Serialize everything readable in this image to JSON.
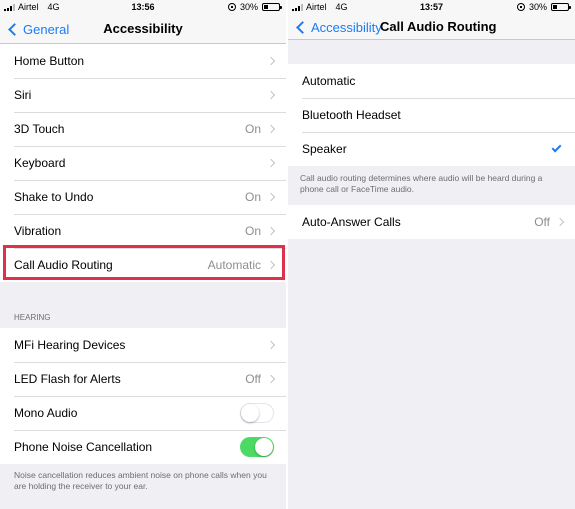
{
  "left": {
    "status": {
      "carrier": "Airtel",
      "network": "4G",
      "time": "13:56",
      "battery": "30%",
      "battery_level": 0.3
    },
    "nav": {
      "back_label": "General",
      "title": "Accessibility"
    },
    "rows": [
      {
        "label": "Home Button",
        "value": ""
      },
      {
        "label": "Siri",
        "value": ""
      },
      {
        "label": "3D Touch",
        "value": "On"
      },
      {
        "label": "Keyboard",
        "value": ""
      },
      {
        "label": "Shake to Undo",
        "value": "On"
      },
      {
        "label": "Vibration",
        "value": "On"
      },
      {
        "label": "Call Audio Routing",
        "value": "Automatic"
      }
    ],
    "hearing": {
      "header": "HEARING",
      "rows": [
        {
          "label": "MFi Hearing Devices",
          "value": ""
        },
        {
          "label": "LED Flash for Alerts",
          "value": "Off"
        },
        {
          "label": "Mono Audio",
          "toggle": "off"
        },
        {
          "label": "Phone Noise Cancellation",
          "toggle": "on"
        }
      ],
      "footer": "Noise cancellation reduces ambient noise on phone calls when you are holding the receiver to your ear."
    },
    "highlight_color": "#e0314c"
  },
  "right": {
    "status": {
      "carrier": "Airtel",
      "network": "4G",
      "time": "13:57",
      "battery": "30%",
      "battery_level": 0.3
    },
    "nav": {
      "back_label": "Accessibility",
      "title": "Call Audio Routing"
    },
    "options": [
      {
        "label": "Automatic",
        "selected": false
      },
      {
        "label": "Bluetooth Headset",
        "selected": false
      },
      {
        "label": "Speaker",
        "selected": true
      }
    ],
    "footer": "Call audio routing determines where audio will be heard during a phone call or FaceTime audio.",
    "auto_answer": {
      "label": "Auto-Answer Calls",
      "value": "Off"
    }
  },
  "colors": {
    "accent": "#1b7cf6",
    "toggle_on": "#4cd964",
    "background": "#efeff4"
  }
}
